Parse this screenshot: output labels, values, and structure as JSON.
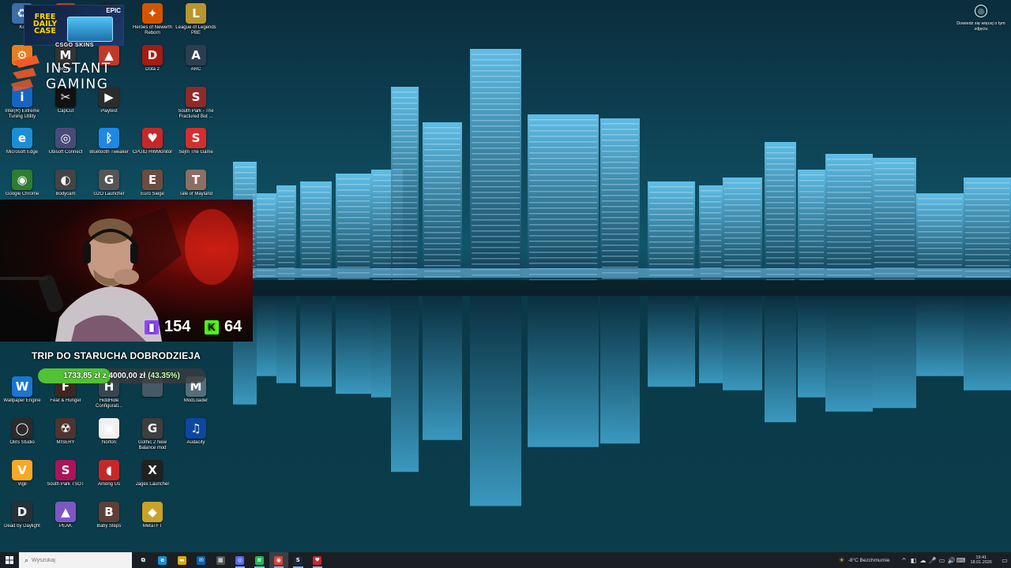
{
  "desktop": {
    "icons": [
      {
        "label": "Ko",
        "glyph": "♻",
        "color": "#3b6ea8"
      },
      {
        "label": "",
        "glyph": "",
        "color": "#c0392b"
      },
      {
        "label": "",
        "glyph": "EPIC",
        "color": "#222222"
      },
      {
        "label": "Heroes of Newerth Reborn",
        "glyph": "✦",
        "color": "#d35400"
      },
      {
        "label": "League of Legends PBE",
        "glyph": "L",
        "color": "#b8962e"
      },
      {
        "label": "",
        "glyph": "⚙",
        "color": "#e67e22"
      },
      {
        "label": "Monk",
        "glyph": "M",
        "color": "#333333"
      },
      {
        "label": "",
        "glyph": "▲",
        "color": "#c0392b"
      },
      {
        "label": "Dota 2",
        "glyph": "D",
        "color": "#a61b12"
      },
      {
        "label": "ARC",
        "glyph": "A",
        "color": "#2c3e50"
      },
      {
        "label": "Intel(R) Extreme Tuning Utility",
        "glyph": "i",
        "color": "#1565c0"
      },
      {
        "label": "CapCut",
        "glyph": "✂",
        "color": "#111111"
      },
      {
        "label": "Playtest",
        "glyph": "▶",
        "color": "#2c2c2c"
      },
      {
        "label": "South Park - The Fractured But ...",
        "glyph": "S",
        "color": "#8e2a2a"
      },
      {
        "label": "Microsoft Edge",
        "glyph": "e",
        "color": "#1a8fd8"
      },
      {
        "label": "Ubisoft Connect",
        "glyph": "◎",
        "color": "#4a4a7a"
      },
      {
        "label": "Bluetooth Tweaker",
        "glyph": "ᛒ",
        "color": "#1e88e5"
      },
      {
        "label": "CPUID HWMonitor",
        "glyph": "♥",
        "color": "#c62828"
      },
      {
        "label": "Sejm The Game",
        "glyph": "S",
        "color": "#d32f2f"
      },
      {
        "label": "Google Chrome",
        "glyph": "◉",
        "color": "#2e7d32"
      },
      {
        "label": "Bodycam",
        "glyph": "◐",
        "color": "#444444"
      },
      {
        "label": "G2O Launcher",
        "glyph": "G",
        "color": "#555555"
      },
      {
        "label": "Euro Siege",
        "glyph": "E",
        "color": "#6d4c41"
      },
      {
        "label": "Tale of Mayland",
        "glyph": "T",
        "color": "#8d6e63"
      },
      {
        "label": "Wallpaper Engine",
        "glyph": "W",
        "color": "#1976d2"
      },
      {
        "label": "Fear & Hunger",
        "glyph": "F",
        "color": "#3e2723"
      },
      {
        "label": "HiddHide Configurati...",
        "glyph": "H",
        "color": "#37474f"
      },
      {
        "label": "",
        "glyph": "",
        "color": "#455a64"
      },
      {
        "label": "ModLoader",
        "glyph": "M",
        "color": "#546e7a"
      },
      {
        "label": "OBS Studio",
        "glyph": "◯",
        "color": "#2b2b2b"
      },
      {
        "label": "MISERY",
        "glyph": "☢",
        "color": "#4e342e"
      },
      {
        "label": "Norton",
        "glyph": "▣",
        "color": "#f0f0f0"
      },
      {
        "label": "Gothic 2 New Balance mod",
        "glyph": "G",
        "color": "#3e3e3e"
      },
      {
        "label": "Audacity",
        "glyph": "♫",
        "color": "#0d47a1"
      },
      {
        "label": "Vigil",
        "glyph": "V",
        "color": "#f9a825"
      },
      {
        "label": "South Park TSOT",
        "glyph": "S",
        "color": "#ad1457"
      },
      {
        "label": "Among Us",
        "glyph": "◖",
        "color": "#c62828"
      },
      {
        "label": "Jagex Launcher",
        "glyph": "X",
        "color": "#212121"
      },
      {
        "label": "Dead by Daylight",
        "glyph": "D",
        "color": "#263238"
      },
      {
        "label": "PEAK",
        "glyph": "▲",
        "color": "#7e57c2"
      },
      {
        "label": "Baby Steps",
        "glyph": "B",
        "color": "#5d4037"
      },
      {
        "label": "MetaTFT",
        "glyph": "◆",
        "color": "#c9a227"
      }
    ]
  },
  "overlay": {
    "free_case": {
      "text": "FREE DAILY CASE",
      "brand": "EPIC"
    },
    "csgo_skins": "CSGO SKINS",
    "instant_gaming": "INSTANT GAMING",
    "webcam": {
      "twitch_subs": "154",
      "kick_subs": "64"
    },
    "goal": {
      "title": "TRIP DO STARUCHA DOBRODZIEJA",
      "raised": "1733,85 zł",
      "separator": "z",
      "target": "4000,00 zł",
      "percent_text": "(43.35%)",
      "progress": 0.4335
    }
  },
  "top_right": {
    "learn_more": "Dowiedz się więcej o tym zdjęciu"
  },
  "taskbar": {
    "search_placeholder": "Wyszukaj",
    "apps": [
      {
        "name": "task-view",
        "glyph": "⧉",
        "color": "#1b1f23"
      },
      {
        "name": "edge",
        "glyph": "e",
        "color": "#1a8fd8"
      },
      {
        "name": "file-explorer",
        "glyph": "▬",
        "color": "#e0a800"
      },
      {
        "name": "outlook",
        "glyph": "✉",
        "color": "#0a64ad"
      },
      {
        "name": "calendar",
        "glyph": "▦",
        "color": "#555555"
      },
      {
        "name": "discord",
        "glyph": "◎",
        "color": "#5865f2"
      },
      {
        "name": "spotify",
        "glyph": "≋",
        "color": "#1db954"
      },
      {
        "name": "chrome",
        "glyph": "◉",
        "color": "#db4437"
      },
      {
        "name": "steam",
        "glyph": "S",
        "color": "#1b2838"
      },
      {
        "name": "hwmonitor",
        "glyph": "♥",
        "color": "#c62828"
      }
    ],
    "weather": "-8°C  Bezchmurnie",
    "tray_icons": [
      "^",
      "◧",
      "☁",
      "🎤",
      "▭",
      "🔊",
      "⌨"
    ],
    "time": "19:41",
    "date": "18.01.2026"
  }
}
